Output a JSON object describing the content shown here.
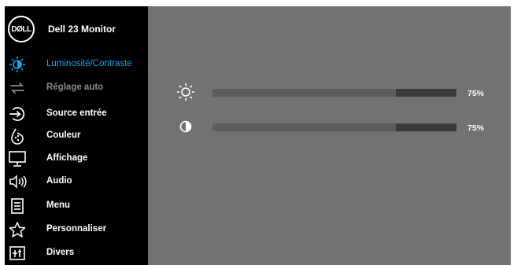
{
  "header": {
    "brand": "DØLL",
    "model": "Dell 23 Monitor"
  },
  "menu": [
    {
      "label": "Luminosité/Contraste",
      "icon": "brightness-contrast-icon",
      "state": "active"
    },
    {
      "label": "Réglage auto",
      "icon": "auto-adjust-icon",
      "state": "disabled"
    },
    {
      "label": "Source entrée",
      "icon": "input-source-icon",
      "state": "normal"
    },
    {
      "label": "Couleur",
      "icon": "color-icon",
      "state": "normal"
    },
    {
      "label": "Affichage",
      "icon": "display-icon",
      "state": "normal"
    },
    {
      "label": "Audio",
      "icon": "speaker-icon",
      "state": "normal"
    },
    {
      "label": "Menu",
      "icon": "menu-icon",
      "state": "normal"
    },
    {
      "label": "Personnaliser",
      "icon": "star-icon",
      "state": "normal"
    },
    {
      "label": "Divers",
      "icon": "other-icon",
      "state": "normal"
    }
  ],
  "sliders": [
    {
      "name": "brightness",
      "icon": "brightness-icon",
      "value": 75,
      "value_label": "75%"
    },
    {
      "name": "contrast",
      "icon": "contrast-icon",
      "value": 75,
      "value_label": "75%"
    }
  ],
  "colors": {
    "accent": "#1aa3e8",
    "panel": "#727272",
    "sidebar": "#000000"
  }
}
